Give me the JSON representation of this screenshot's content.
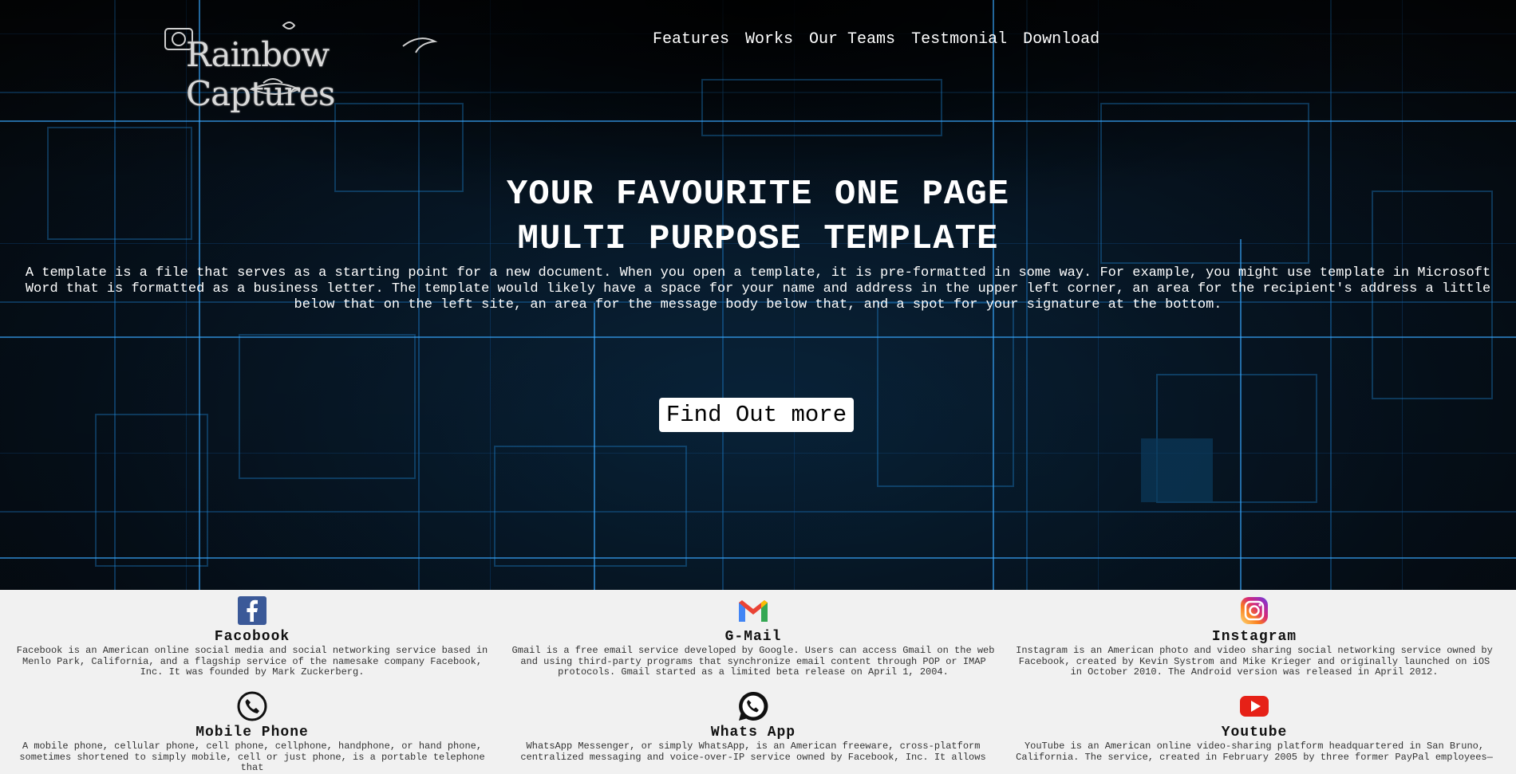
{
  "brand": {
    "logo_text": "Rainbow Captures"
  },
  "nav": {
    "items": [
      {
        "label": "Features"
      },
      {
        "label": "Works"
      },
      {
        "label": "Our Teams"
      },
      {
        "label": "Testmonial"
      },
      {
        "label": "Download"
      }
    ]
  },
  "hero": {
    "title_line1": "YOUR FAVOURITE ONE PAGE",
    "title_line2": "MULTI PURPOSE TEMPLATE",
    "description": "A template is a file that serves as a starting point for a new document. When you open a template, it is pre-formatted in some way. For example, you might use template in Microsoft Word that is formatted as a business letter. The template would likely have a space for your name and address in the upper left corner, an area for the recipient's address a little below that on the left site, an area for the message body below that, and a spot for your signature at the bottom.",
    "cta_label": "Find Out more"
  },
  "features": [
    {
      "icon": "facebook-icon",
      "title": "Facobook",
      "text": "Facebook is an American online social media and social networking service based in Menlo Park, California, and a flagship service of the namesake company Facebook, Inc. It was founded by Mark Zuckerberg."
    },
    {
      "icon": "gmail-icon",
      "title": "G-Mail",
      "text": "Gmail is a free email service developed by Google. Users can access Gmail on the web and using third-party programs that synchronize email content through POP or IMAP protocols. Gmail started as a limited beta release on April 1, 2004."
    },
    {
      "icon": "instagram-icon",
      "title": "Instagram",
      "text": "Instagram is an American photo and video sharing social networking service owned by Facebook, created by Kevin Systrom and Mike Krieger and originally launched on iOS in October 2010. The Android version was released in April 2012."
    },
    {
      "icon": "phone-icon",
      "title": "Mobile Phone",
      "text": "A mobile phone, cellular phone, cell phone, cellphone, handphone, or hand phone, sometimes shortened to simply mobile, cell or just phone, is a portable telephone that"
    },
    {
      "icon": "whatsapp-icon",
      "title": "Whats App",
      "text": "WhatsApp Messenger, or simply WhatsApp, is an American freeware, cross-platform centralized messaging and voice-over-IP service owned by Facebook, Inc. It allows"
    },
    {
      "icon": "youtube-icon",
      "title": "Youtube",
      "text": "YouTube is an American online video-sharing platform headquartered in San Bruno, California. The service, created in February 2005 by three former PayPal employees—"
    }
  ],
  "colors": {
    "hero_bg": "#050608",
    "grid_blue": "#1e8ce6",
    "features_bg": "#f1f1f1",
    "facebook_blue": "#3b5998",
    "youtube_red": "#e62117"
  }
}
